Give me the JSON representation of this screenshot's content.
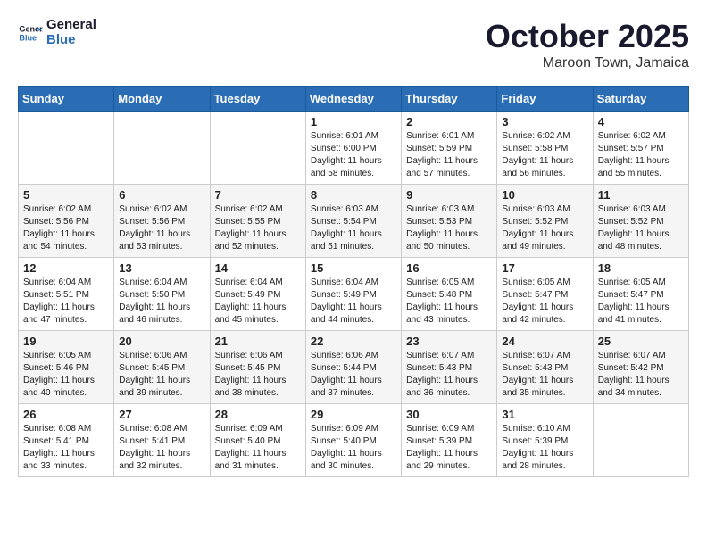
{
  "header": {
    "logo_line1": "General",
    "logo_line2": "Blue",
    "month": "October 2025",
    "location": "Maroon Town, Jamaica"
  },
  "weekdays": [
    "Sunday",
    "Monday",
    "Tuesday",
    "Wednesday",
    "Thursday",
    "Friday",
    "Saturday"
  ],
  "weeks": [
    [
      {
        "day": "",
        "info": ""
      },
      {
        "day": "",
        "info": ""
      },
      {
        "day": "",
        "info": ""
      },
      {
        "day": "1",
        "info": "Sunrise: 6:01 AM\nSunset: 6:00 PM\nDaylight: 11 hours\nand 58 minutes."
      },
      {
        "day": "2",
        "info": "Sunrise: 6:01 AM\nSunset: 5:59 PM\nDaylight: 11 hours\nand 57 minutes."
      },
      {
        "day": "3",
        "info": "Sunrise: 6:02 AM\nSunset: 5:58 PM\nDaylight: 11 hours\nand 56 minutes."
      },
      {
        "day": "4",
        "info": "Sunrise: 6:02 AM\nSunset: 5:57 PM\nDaylight: 11 hours\nand 55 minutes."
      }
    ],
    [
      {
        "day": "5",
        "info": "Sunrise: 6:02 AM\nSunset: 5:56 PM\nDaylight: 11 hours\nand 54 minutes."
      },
      {
        "day": "6",
        "info": "Sunrise: 6:02 AM\nSunset: 5:56 PM\nDaylight: 11 hours\nand 53 minutes."
      },
      {
        "day": "7",
        "info": "Sunrise: 6:02 AM\nSunset: 5:55 PM\nDaylight: 11 hours\nand 52 minutes."
      },
      {
        "day": "8",
        "info": "Sunrise: 6:03 AM\nSunset: 5:54 PM\nDaylight: 11 hours\nand 51 minutes."
      },
      {
        "day": "9",
        "info": "Sunrise: 6:03 AM\nSunset: 5:53 PM\nDaylight: 11 hours\nand 50 minutes."
      },
      {
        "day": "10",
        "info": "Sunrise: 6:03 AM\nSunset: 5:52 PM\nDaylight: 11 hours\nand 49 minutes."
      },
      {
        "day": "11",
        "info": "Sunrise: 6:03 AM\nSunset: 5:52 PM\nDaylight: 11 hours\nand 48 minutes."
      }
    ],
    [
      {
        "day": "12",
        "info": "Sunrise: 6:04 AM\nSunset: 5:51 PM\nDaylight: 11 hours\nand 47 minutes."
      },
      {
        "day": "13",
        "info": "Sunrise: 6:04 AM\nSunset: 5:50 PM\nDaylight: 11 hours\nand 46 minutes."
      },
      {
        "day": "14",
        "info": "Sunrise: 6:04 AM\nSunset: 5:49 PM\nDaylight: 11 hours\nand 45 minutes."
      },
      {
        "day": "15",
        "info": "Sunrise: 6:04 AM\nSunset: 5:49 PM\nDaylight: 11 hours\nand 44 minutes."
      },
      {
        "day": "16",
        "info": "Sunrise: 6:05 AM\nSunset: 5:48 PM\nDaylight: 11 hours\nand 43 minutes."
      },
      {
        "day": "17",
        "info": "Sunrise: 6:05 AM\nSunset: 5:47 PM\nDaylight: 11 hours\nand 42 minutes."
      },
      {
        "day": "18",
        "info": "Sunrise: 6:05 AM\nSunset: 5:47 PM\nDaylight: 11 hours\nand 41 minutes."
      }
    ],
    [
      {
        "day": "19",
        "info": "Sunrise: 6:05 AM\nSunset: 5:46 PM\nDaylight: 11 hours\nand 40 minutes."
      },
      {
        "day": "20",
        "info": "Sunrise: 6:06 AM\nSunset: 5:45 PM\nDaylight: 11 hours\nand 39 minutes."
      },
      {
        "day": "21",
        "info": "Sunrise: 6:06 AM\nSunset: 5:45 PM\nDaylight: 11 hours\nand 38 minutes."
      },
      {
        "day": "22",
        "info": "Sunrise: 6:06 AM\nSunset: 5:44 PM\nDaylight: 11 hours\nand 37 minutes."
      },
      {
        "day": "23",
        "info": "Sunrise: 6:07 AM\nSunset: 5:43 PM\nDaylight: 11 hours\nand 36 minutes."
      },
      {
        "day": "24",
        "info": "Sunrise: 6:07 AM\nSunset: 5:43 PM\nDaylight: 11 hours\nand 35 minutes."
      },
      {
        "day": "25",
        "info": "Sunrise: 6:07 AM\nSunset: 5:42 PM\nDaylight: 11 hours\nand 34 minutes."
      }
    ],
    [
      {
        "day": "26",
        "info": "Sunrise: 6:08 AM\nSunset: 5:41 PM\nDaylight: 11 hours\nand 33 minutes."
      },
      {
        "day": "27",
        "info": "Sunrise: 6:08 AM\nSunset: 5:41 PM\nDaylight: 11 hours\nand 32 minutes."
      },
      {
        "day": "28",
        "info": "Sunrise: 6:09 AM\nSunset: 5:40 PM\nDaylight: 11 hours\nand 31 minutes."
      },
      {
        "day": "29",
        "info": "Sunrise: 6:09 AM\nSunset: 5:40 PM\nDaylight: 11 hours\nand 30 minutes."
      },
      {
        "day": "30",
        "info": "Sunrise: 6:09 AM\nSunset: 5:39 PM\nDaylight: 11 hours\nand 29 minutes."
      },
      {
        "day": "31",
        "info": "Sunrise: 6:10 AM\nSunset: 5:39 PM\nDaylight: 11 hours\nand 28 minutes."
      },
      {
        "day": "",
        "info": ""
      }
    ]
  ]
}
